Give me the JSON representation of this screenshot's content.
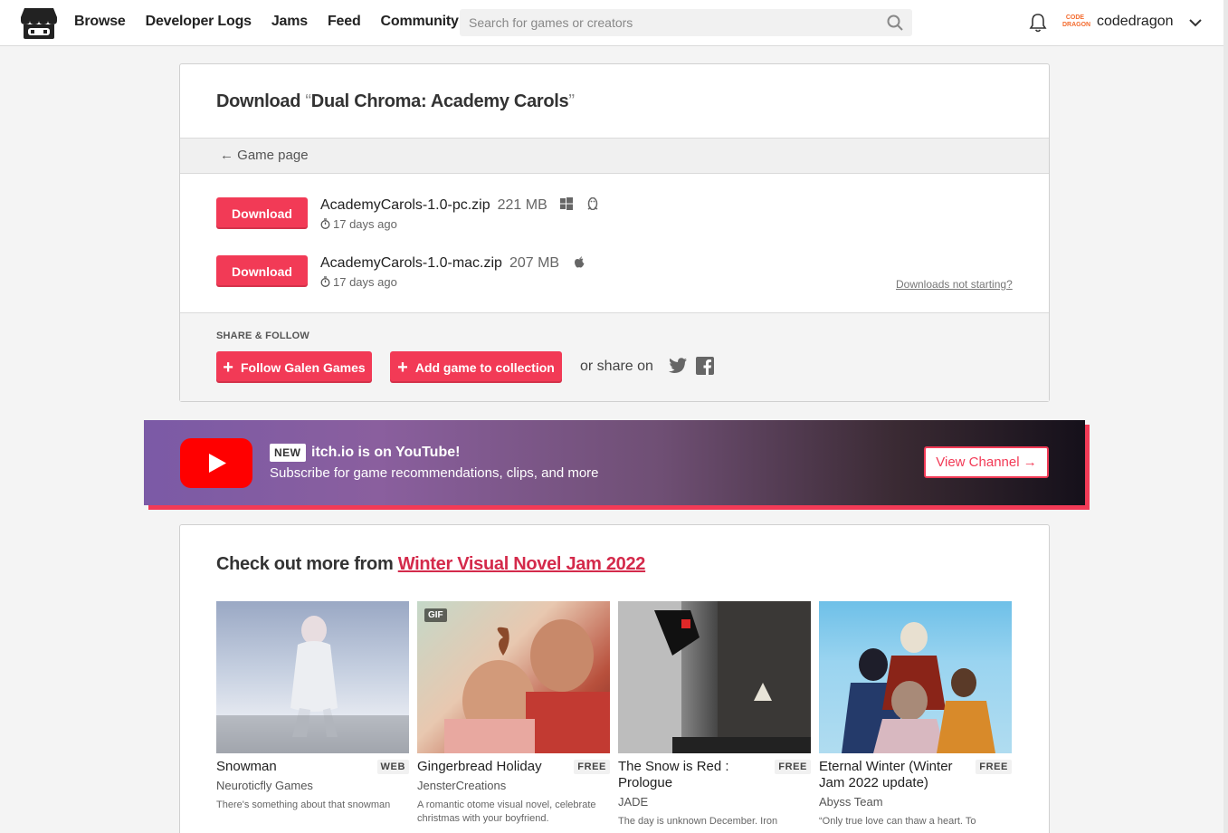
{
  "header": {
    "nav": [
      "Browse",
      "Developer Logs",
      "Jams",
      "Feed",
      "Community"
    ],
    "search_placeholder": "Search for games or creators",
    "avatar_text": "CODE DRAGON",
    "username": "codedragon"
  },
  "download": {
    "title_prefix": "Download",
    "open_quote": "“",
    "game_title": "Dual Chroma: Academy Carols",
    "close_quote": "”",
    "back_link": "← Game page",
    "files": [
      {
        "button": "Download",
        "name": "AcademyCarols-1.0-pc.zip",
        "size": "221 MB",
        "date": "17 days ago"
      },
      {
        "button": "Download",
        "name": "AcademyCarols-1.0-mac.zip",
        "size": "207 MB",
        "date": "17 days ago"
      }
    ],
    "not_starting": "Downloads not starting?"
  },
  "share": {
    "label": "SHARE & FOLLOW",
    "follow": "Follow Galen Games",
    "collection": "Add game to collection",
    "share_on": "or share on"
  },
  "youtube": {
    "badge": "NEW",
    "title": "itch.io is on YouTube!",
    "subtitle": "Subscribe for game recommendations, clips, and more",
    "button": "View Channel →"
  },
  "more": {
    "prefix": "Check out more from",
    "jam": "Winter Visual Novel Jam 2022",
    "games": [
      {
        "title": "Snowman",
        "price": "WEB",
        "author": "Neuroticfly Games",
        "desc": "There's something about that snowman"
      },
      {
        "title": "Gingerbread Holiday",
        "price": "FREE",
        "author": "JensterCreations",
        "desc": "A romantic otome visual novel, celebrate christmas with your boyfriend.",
        "badge": "GIF"
      },
      {
        "title": "The Snow is Red : Prologue",
        "price": "FREE",
        "author": "JADE",
        "desc": "The day is unknown December. Iron"
      },
      {
        "title": "Eternal Winter (Winter Jam 2022 update)",
        "price": "FREE",
        "author": "Abyss Team",
        "desc": "“Only true love can thaw a heart. To"
      }
    ]
  },
  "colors": {
    "accent": "#f23a56",
    "link": "#d42a4b"
  }
}
